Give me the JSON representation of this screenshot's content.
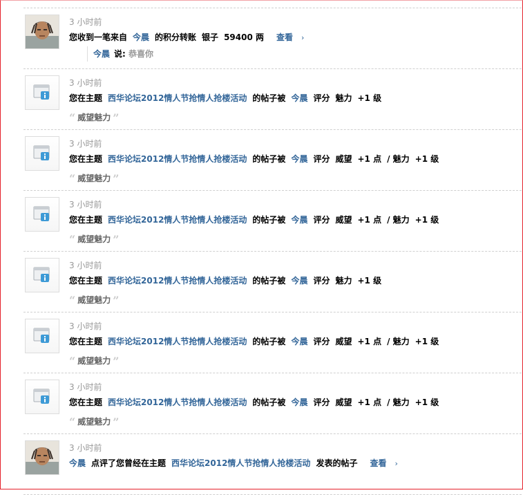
{
  "notices": [
    {
      "type": "transfer",
      "icon": "user-avatar",
      "time": "3 小时前",
      "parts": [
        "您收到一笔来自",
        "今晨",
        "的积分转账",
        "银子",
        "59400 两"
      ],
      "more": "查看",
      "reply_user": "今晨",
      "reply_said": "说:",
      "reply_text": "恭喜你"
    },
    {
      "type": "rating",
      "icon": "system-notice",
      "time": "3 小时前",
      "parts": [
        "您在主题",
        "西华论坛2012情人节抢情人抢楼活动",
        "的帖子被",
        "今晨",
        "评分",
        "魅力",
        "+1 级"
      ],
      "quote": "威望魅力"
    },
    {
      "type": "rating",
      "icon": "system-notice",
      "time": "3 小时前",
      "parts": [
        "您在主题",
        "西华论坛2012情人节抢情人抢楼活动",
        "的帖子被",
        "今晨",
        "评分",
        "威望",
        "+1 点",
        "/ 魅力",
        "+1 级"
      ],
      "quote": "威望魅力"
    },
    {
      "type": "rating",
      "icon": "system-notice",
      "time": "3 小时前",
      "parts": [
        "您在主题",
        "西华论坛2012情人节抢情人抢楼活动",
        "的帖子被",
        "今晨",
        "评分",
        "威望",
        "+1 点",
        "/ 魅力",
        "+1 级"
      ],
      "quote": "威望魅力"
    },
    {
      "type": "rating",
      "icon": "system-notice",
      "time": "3 小时前",
      "parts": [
        "您在主题",
        "西华论坛2012情人节抢情人抢楼活动",
        "的帖子被",
        "今晨",
        "评分",
        "魅力",
        "+1 级"
      ],
      "quote": "威望魅力"
    },
    {
      "type": "rating",
      "icon": "system-notice",
      "time": "3 小时前",
      "parts": [
        "您在主题",
        "西华论坛2012情人节抢情人抢楼活动",
        "的帖子被",
        "今晨",
        "评分",
        "威望",
        "+1 点",
        "/ 魅力",
        "+1 级"
      ],
      "quote": "威望魅力"
    },
    {
      "type": "rating",
      "icon": "system-notice",
      "time": "3 小时前",
      "parts": [
        "您在主题",
        "西华论坛2012情人节抢情人抢楼活动",
        "的帖子被",
        "今晨",
        "评分",
        "威望",
        "+1 点",
        "/ 魅力",
        "+1 级"
      ],
      "quote": "威望魅力"
    },
    {
      "type": "comment",
      "icon": "user-avatar",
      "time": "3 小时前",
      "parts": [
        "今晨",
        "点评了您曾经在主题",
        "西华论坛2012情人节抢情人抢楼活动",
        "发表的帖子"
      ],
      "more": "查看"
    }
  ],
  "colors": {
    "link": "#336699",
    "time": "#999999",
    "divider": "#cfcfcf",
    "frame": "#e5202a"
  }
}
